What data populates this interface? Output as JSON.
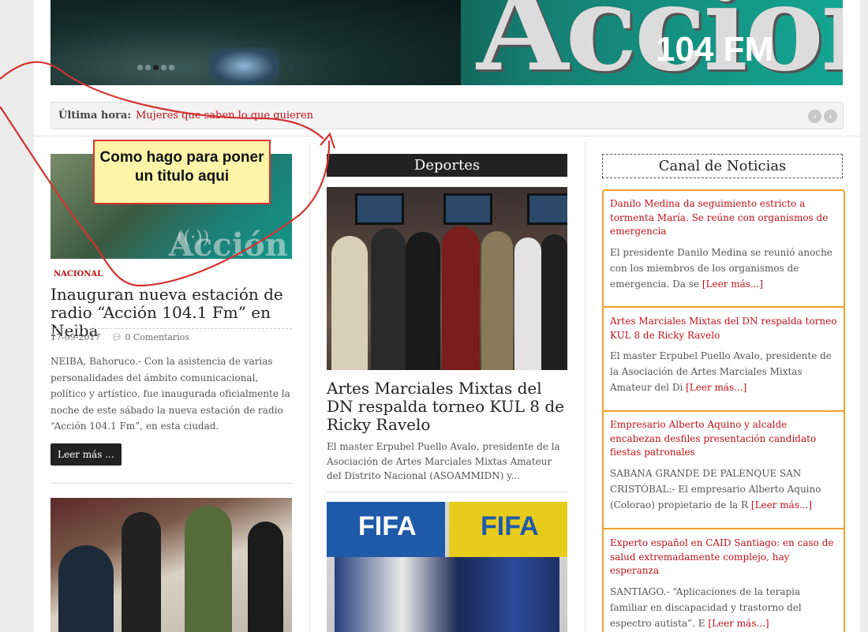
{
  "banner": {
    "logo_text": "Acción",
    "frequency": "104 FM",
    "slide_dots": 5,
    "active_dot": 2
  },
  "ticker": {
    "label": "Última hora:",
    "headline": "Mujeres que saben lo que quieren",
    "prev_icon": "chevron-left-icon",
    "next_icon": "chevron-right-icon"
  },
  "annotation": {
    "text": "Como hago para poner un titulo aqui",
    "color": "#d33333"
  },
  "left_column": {
    "image_text": "Acción",
    "category": "NACIONAL",
    "title": "Inauguran nueva estación de radio “Acción 104.1 Fm” en Neiba",
    "date": "17-09-2017",
    "comments": "0 Comentarios",
    "excerpt": "NEIBA, Bahoruco.- Con la asistencia de varias personalidades del ámbito comunicacional, político y artístico, fue inaugurada oficialmente la noche de este sábado la nueva estación de radio “Acción 104.1 Fm”, en esta ciudad.",
    "read_more": "Leer más ..."
  },
  "center_column": {
    "section_title": "Deportes",
    "title": "Artes Marciales Mixtas del DN respalda torneo KUL 8 de Ricky Ravelo",
    "excerpt": "El master Erpubel Puello Avalo, presidente de la Asociación de Artes Marciales Mixtas Amateur del Distrito Nacional (ASOAMMIDN) y...",
    "second_image_text": "FIFA"
  },
  "right_column": {
    "section_title": "Canal de Noticias",
    "read_more": "[Leer más...]",
    "items": [
      {
        "title": "Danilo Medina da seguimiento estricto a tormenta María. Se reúne con organismos de emergencia",
        "excerpt": "El presidente Danilo Medina se reunió anoche con los miembros de los organismos de emergencia. Da se"
      },
      {
        "title": "Artes Marciales Mixtas del DN respalda torneo KUL 8 de Ricky Ravelo",
        "excerpt": "El master Erpubel Puello Avalo, presidente de la Asociación de Artes Marciales Mixtas Amateur del Di"
      },
      {
        "title": "Empresario Alberto Aquino y alcalde encabezan desfiles presentación candidato fiestas patronales",
        "excerpt": "SABANA GRANDE DE PALENQUE SAN CRISTÓBAL:- El empresario Alberto Aquino (Colorao) propietario de la R"
      },
      {
        "title": "Experto español en CAID Santiago: en caso de salud extremadamente complejo, hay esperanza",
        "excerpt": "SANTIAGO.- “Aplicaciones de la terapia familiar en discapacidad y trastorno del espectro autista”. E"
      }
    ]
  },
  "colors": {
    "accent_red": "#c0121b",
    "box_orange": "#f0a030",
    "dark": "#222222"
  }
}
